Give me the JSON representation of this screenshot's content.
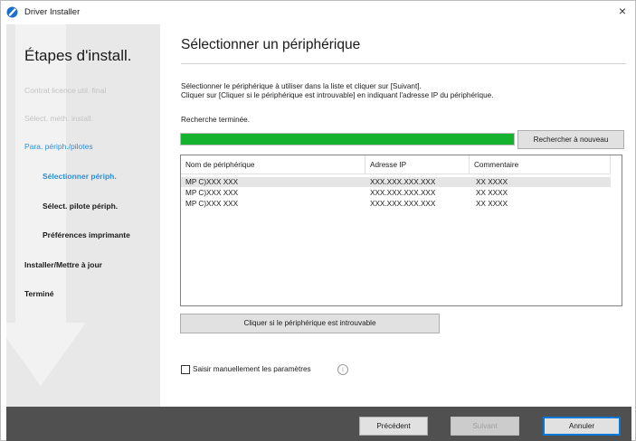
{
  "window": {
    "title": "Driver Installer",
    "close_glyph": "×",
    "app_icon": "driver-installer-icon"
  },
  "sidebar": {
    "heading": "Étapes d'install.",
    "steps": [
      {
        "label": "Contrat licence util. final",
        "state": "done"
      },
      {
        "label": "Sélect. méth. install.",
        "state": "done"
      },
      {
        "label": "Para. périph./pilotes",
        "state": "current"
      },
      {
        "label": "Sélectionner périph.",
        "state": "sub-active"
      },
      {
        "label": "Sélect. pilote périph.",
        "state": "sub"
      },
      {
        "label": "Préférences imprimante",
        "state": "sub"
      },
      {
        "label": "Installer/Mettre à jour",
        "state": "pending"
      },
      {
        "label": "Terminé",
        "state": "pending"
      }
    ]
  },
  "main": {
    "title": "Sélectionner un périphérique",
    "instructions": [
      "Sélectionner le périphérique à utiliser dans la liste et cliquer sur [Suivant].",
      "Cliquer sur [Cliquer si le périphérique est introuvable] en indiquant l'adresse IP du périphérique."
    ],
    "status": "Recherche terminée.",
    "progress": 1.0,
    "search_again_label": "Rechercher à nouveau",
    "list": {
      "columns": [
        "Nom de périphérique",
        "Adresse IP",
        "Commentaire"
      ],
      "rows": [
        [
          "MP C)XXX XXX",
          "XXX.XXX.XXX.XXX",
          "XX XXXX"
        ],
        [
          "MP C)XXX XXX",
          "XXX.XXX.XXX.XXX",
          "XX XXXX"
        ],
        [
          "MP C)XXX XXX",
          "XXX.XXX.XXX.XXX",
          "XX XXXX"
        ]
      ]
    },
    "not_found_label": "Cliquer si le périphérique est introuvable",
    "manual_label": "Saisir manuellement les paramètres",
    "manual_checked": false,
    "info_glyph": "i"
  },
  "footer": {
    "previous": "Précédent",
    "next": "Suivant",
    "cancel": "Annuler"
  },
  "colors": {
    "accent": "#2a8fd8",
    "progress": "#14b22f",
    "footer": "#505050",
    "sidebar": "#e8e8e8"
  }
}
